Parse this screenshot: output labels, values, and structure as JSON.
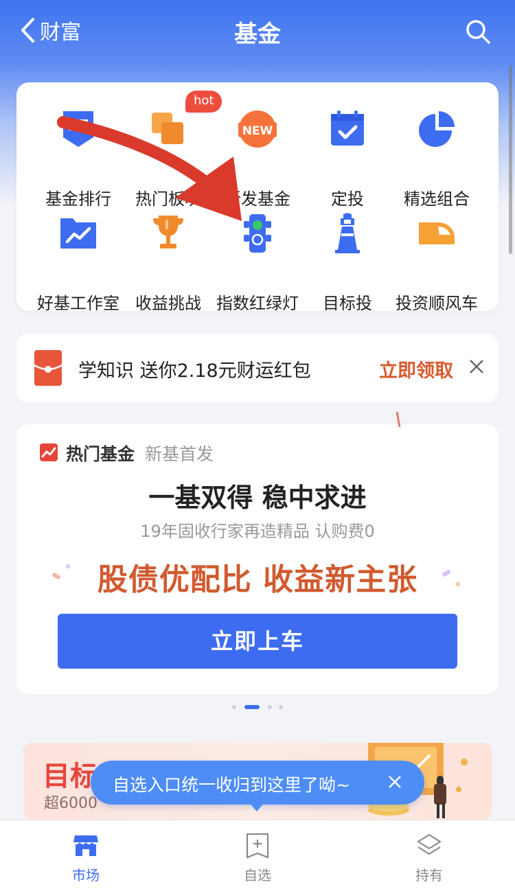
{
  "header": {
    "back_label": "财富",
    "title": "基金"
  },
  "grid": {
    "hot_badge": "hot",
    "items": [
      {
        "label": "基金排行",
        "icon": "fund-rank-icon"
      },
      {
        "label": "热门板块",
        "icon": "hot-sector-icon"
      },
      {
        "label": "新发基金",
        "icon": "new-fund-icon",
        "icon_text": "NEW"
      },
      {
        "label": "定投",
        "icon": "calendar-check-icon"
      },
      {
        "label": "精选组合",
        "icon": "pie-chart-icon"
      },
      {
        "label": "好基工作室",
        "icon": "trend-folder-icon"
      },
      {
        "label": "收益挑战",
        "icon": "trophy-icon"
      },
      {
        "label": "指数红绿灯",
        "icon": "traffic-light-icon"
      },
      {
        "label": "目标投",
        "icon": "lighthouse-icon"
      },
      {
        "label": "投资顺风车",
        "icon": "bullet-train-icon"
      }
    ]
  },
  "promo": {
    "text": "学知识 送你2.18元财运红包",
    "action": "立即领取"
  },
  "hot_fund": {
    "tag": "热门基金",
    "sub_tag": "新基首发",
    "headline": "一基双得 稳中求进",
    "desc": "19年固收行家再造精品 认购费0",
    "slogan": "股债优配比 收益新主张",
    "button": "立即上车"
  },
  "target_banner": {
    "title": "目标",
    "sub": "超6000"
  },
  "tooltip": {
    "text": "自选入口统一收归到这里了呦~"
  },
  "tabbar": {
    "items": [
      {
        "label": "市场",
        "icon": "market-store-icon",
        "active": true
      },
      {
        "label": "自选",
        "icon": "watchlist-add-icon",
        "active": false
      },
      {
        "label": "持有",
        "icon": "holdings-layers-icon",
        "active": false
      }
    ]
  },
  "colors": {
    "primary": "#3d6cf0",
    "accent_red": "#e8463b",
    "slogan_orange": "#d15a2e",
    "annotation_arrow": "#d93a2b"
  }
}
